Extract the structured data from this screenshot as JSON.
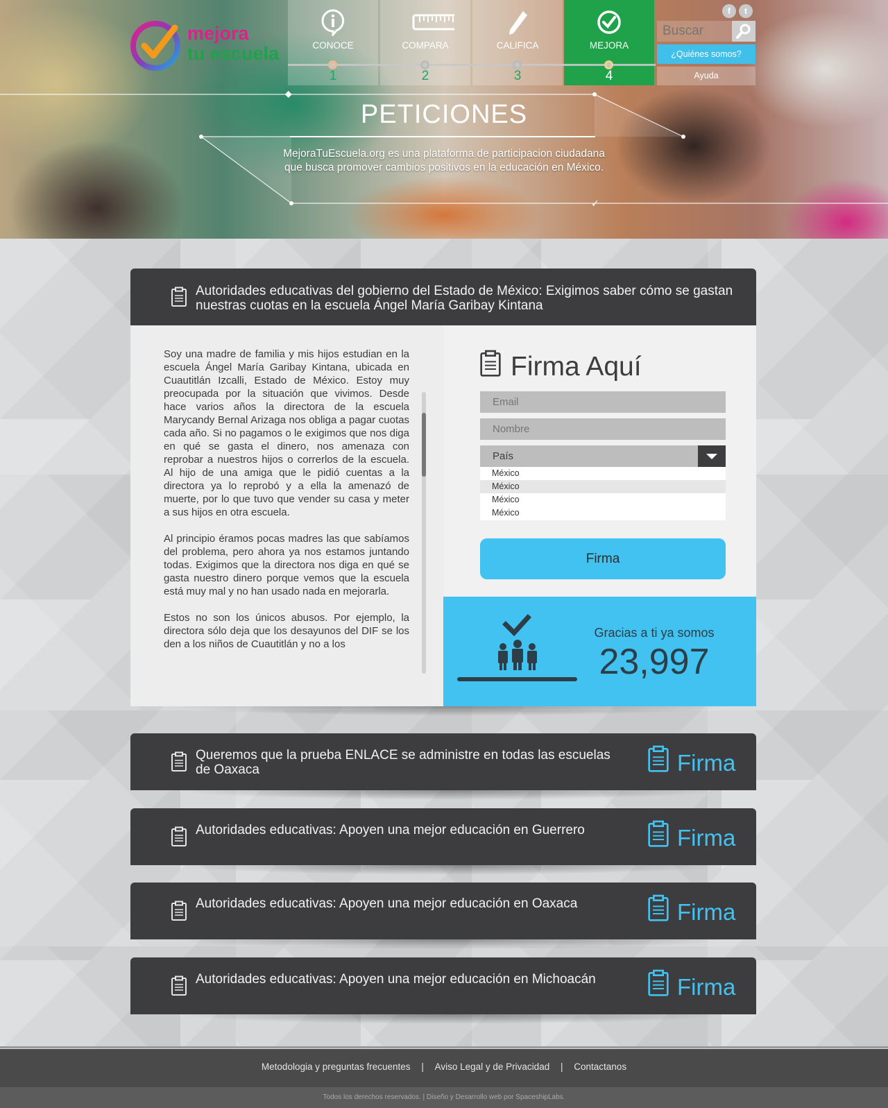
{
  "brand": {
    "line1": "mejora",
    "line2": "tu escuela",
    "color_pink": "#e0208a",
    "color_green": "#1fa24a"
  },
  "nav": {
    "steps": [
      {
        "label": "CONOCE",
        "num": "1",
        "icon": "info-icon"
      },
      {
        "label": "COMPARA",
        "num": "2",
        "icon": "ruler-icon"
      },
      {
        "label": "CALIFICA",
        "num": "3",
        "icon": "pencil-icon"
      },
      {
        "label": "MEJORA",
        "num": "4",
        "icon": "check-circle-icon"
      }
    ],
    "active_step": 4,
    "search_placeholder": "Buscar",
    "quienes": "¿Quiénes somos?",
    "ayuda": "Ayuda",
    "social": [
      "f",
      "t"
    ]
  },
  "hero": {
    "title": "PETICIONES",
    "subtitle": "MejoraTuEscuela.org es una plataforma de participacion ciudadana que busca promover cambios positivos en la educación en México."
  },
  "featured": {
    "title": "Autoridades educativas del gobierno del Estado de México: Exigimos saber cómo se gastan nuestras cuotas en la escuela Ángel María Garibay Kintana",
    "paragraphs": [
      "Soy una madre de familia y mis hijos estudian en la escuela Ángel María Garibay Kintana, ubicada en Cuautitlán Izcalli, Estado de México. Estoy muy preocupada por la situación que vivimos. Desde hace varios años la directora de la escuela Marycandy Bernal Arizaga nos obliga a pagar cuotas cada año. Si no pagamos o le exigimos que nos diga en qué se gasta el dinero, nos amenaza con reprobar a nuestros hijos o correrlos de la escuela. Al hijo de una amiga que le pidió cuentas a la directora ya lo reprobó y a ella la amenazó de muerte, por lo que tuvo que vender su casa y meter a sus hijos en otra escuela.",
      "Al principio éramos pocas madres las que sabíamos del problema, pero ahora ya nos estamos juntando todas. Exigimos que la directora nos diga en qué se gasta nuestro dinero porque vemos que la escuela está muy mal y no han usado nada en mejorarla.",
      "Estos no son los únicos abusos. Por ejemplo, la directora sólo deja que los desayunos del DIF se los den a los niños de Cuautitlán y no a los"
    ],
    "form": {
      "title": "Firma Aquí",
      "email_placeholder": "Email",
      "name_placeholder": "Nombre",
      "country_placeholder": "País",
      "country_options": [
        "México",
        "México",
        "México",
        "México"
      ],
      "submit": "Firma"
    },
    "counter": {
      "text": "Gracias a ti ya somos",
      "value": "23,997"
    }
  },
  "petitions": [
    {
      "title": "Queremos que la prueba ENLACE se administre en todas las escuelas de Oaxaca",
      "action": "Firma"
    },
    {
      "title": "Autoridades educativas: Apoyen una mejor educación en Guerrero",
      "action": "Firma"
    },
    {
      "title": "Autoridades educativas: Apoyen una mejor educación en Oaxaca",
      "action": "Firma"
    },
    {
      "title": "Autoridades educativas: Apoyen una mejor educación en Michoacán",
      "action": "Firma"
    }
  ],
  "footer": {
    "links": [
      "Metodologia y preguntas frecuentes",
      "|",
      "Aviso Legal  y  de Privacidad",
      "|",
      "Contactanos"
    ],
    "copyright": "Todos los derechos reservados. | Diseño y Desarrollo web por SpaceshipLabs."
  },
  "colors": {
    "accent": "#41c2f0",
    "dark": "#3d3d3f",
    "green": "#1fa24a"
  }
}
